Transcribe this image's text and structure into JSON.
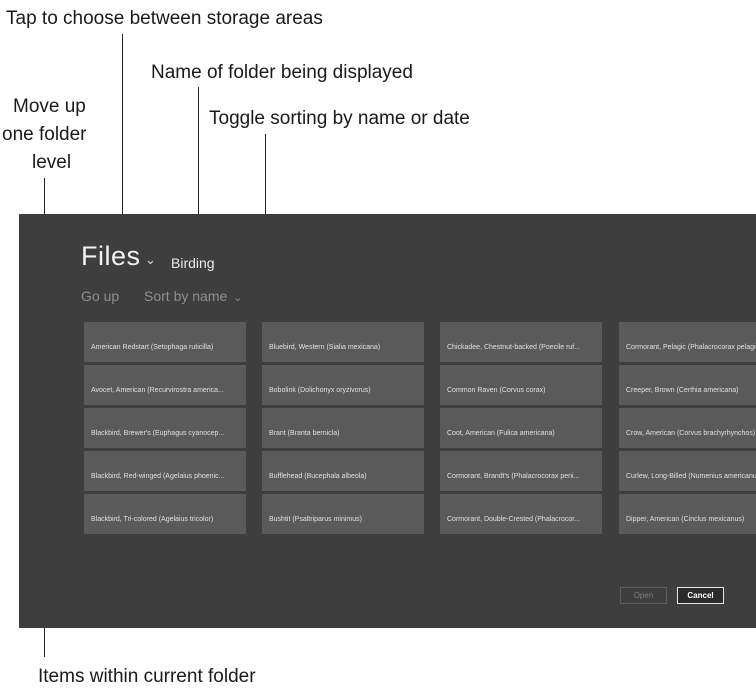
{
  "callouts": {
    "storage_areas": "Tap to choose between storage areas",
    "folder_name": "Name of folder being displayed",
    "up_line1": "Move up",
    "up_line2": "one folder",
    "up_line3": "level",
    "sort_toggle": "Toggle sorting by name or date",
    "items": "Items within current folder"
  },
  "app": {
    "title": "Files",
    "folder": "Birding",
    "go_up": "Go up",
    "sort_label": "Sort by name",
    "open_label": "Open",
    "cancel_label": "Cancel"
  },
  "icons": {
    "storage_chevron": "chevron-down-icon",
    "sort_chevron": "chevron-down-icon"
  },
  "items": [
    [
      "American Redstart (Setophaga ruticilla)",
      "Bluebird, Western (Sialia mexicana)",
      "Chickadee, Chestnut-backed (Poecile ruf...",
      "Cormorant, Pelagic (Phalacrocorax pelagicus)"
    ],
    [
      "Avocet, American (Recurvirostra america...",
      "Bobolink (Dolichonyx oryzivorus)",
      "Common Raven (Corvus corax)",
      "Creeper, Brown (Certhia americana)"
    ],
    [
      "Blackbird, Brewer's (Euphagus cyanocep...",
      "Brant (Branta bernicla)",
      "Coot, American (Fulica americana)",
      "Crow, American (Corvus brachyrhynchos)"
    ],
    [
      "Blackbird, Red-winged (Agelaius phoenic...",
      "Bufflehead (Bucephala albeola)",
      "Cormorant, Brandt's (Phalacrocorax peni...",
      "Curlew, Long-Billed (Numenius americanus)"
    ],
    [
      "Blackbird, Tri-colored (Agelaius tricolor)",
      "Bushtit (Psaltriparus minimus)",
      "Cormorant, Double-Crested (Phalacrocor...",
      "Dipper, American (Cinclus mexicanus)"
    ]
  ],
  "colors": {
    "panel": "#3e3e3e",
    "tile": "#5a5a5a"
  }
}
